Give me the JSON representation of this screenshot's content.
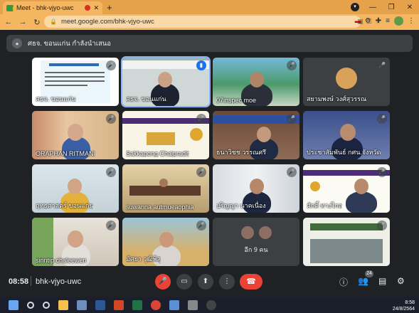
{
  "browser": {
    "tab_title": "Meet - bhk-vjyo-uwc",
    "close_glyph": "✕",
    "new_tab_glyph": "+",
    "url": "meet.google.com/bhk-vjyo-uwc",
    "window_buttons": [
      "—",
      "❐",
      "✕"
    ]
  },
  "meet": {
    "presenter_label": "ศธจ. ขอนแก่น กำลังนำเสนอ",
    "tiles": [
      {
        "name": "ศธจ. ขอนแก่น",
        "mic": "🎤"
      },
      {
        "name": "ศธจ. ขอนแก่น",
        "mic": "▮"
      },
      {
        "name": "07inspec moe",
        "mic": "🎤"
      },
      {
        "name": "สยามพงษ์ วงศ์สุวรรณ",
        "mic": "🎤"
      },
      {
        "name": "ORAPHAN RITMANI",
        "mic": "🎤"
      },
      {
        "name": "Sakkapong Chaipradit",
        "mic": "🎤"
      },
      {
        "name": "ธนาวิชช วรรณศรี",
        "mic": "🎤"
      },
      {
        "name": "ประชาสัมพันธ์ กศน.จังหวัด",
        "mic": "🎤"
      },
      {
        "name": "ฤทธศาสตร์ ขอนแก่น",
        "mic": "🎤"
      },
      {
        "name": "suwanna autmueaophia",
        "mic": "🎤"
      },
      {
        "name": "ปริญญา นาคเนื่อง",
        "mic": "🎤"
      },
      {
        "name": "ศักดิ์ ทางไกล",
        "mic": "🎤"
      },
      {
        "name": "sirintip chaleewen",
        "mic": "🎤"
      },
      {
        "name": "มัศยา วุฒิพิสุ",
        "mic": "🎤"
      },
      {
        "name": "more",
        "more_label": "อีก 9 คน"
      },
      {
        "name": "",
        "mic": "🎤"
      }
    ],
    "bottom": {
      "time": "08:58",
      "meeting_code": "bhk-vjyo-uwc",
      "participant_count": "24"
    }
  },
  "taskbar": {
    "clock_time": "8:58",
    "clock_date": "24/8/2564"
  }
}
